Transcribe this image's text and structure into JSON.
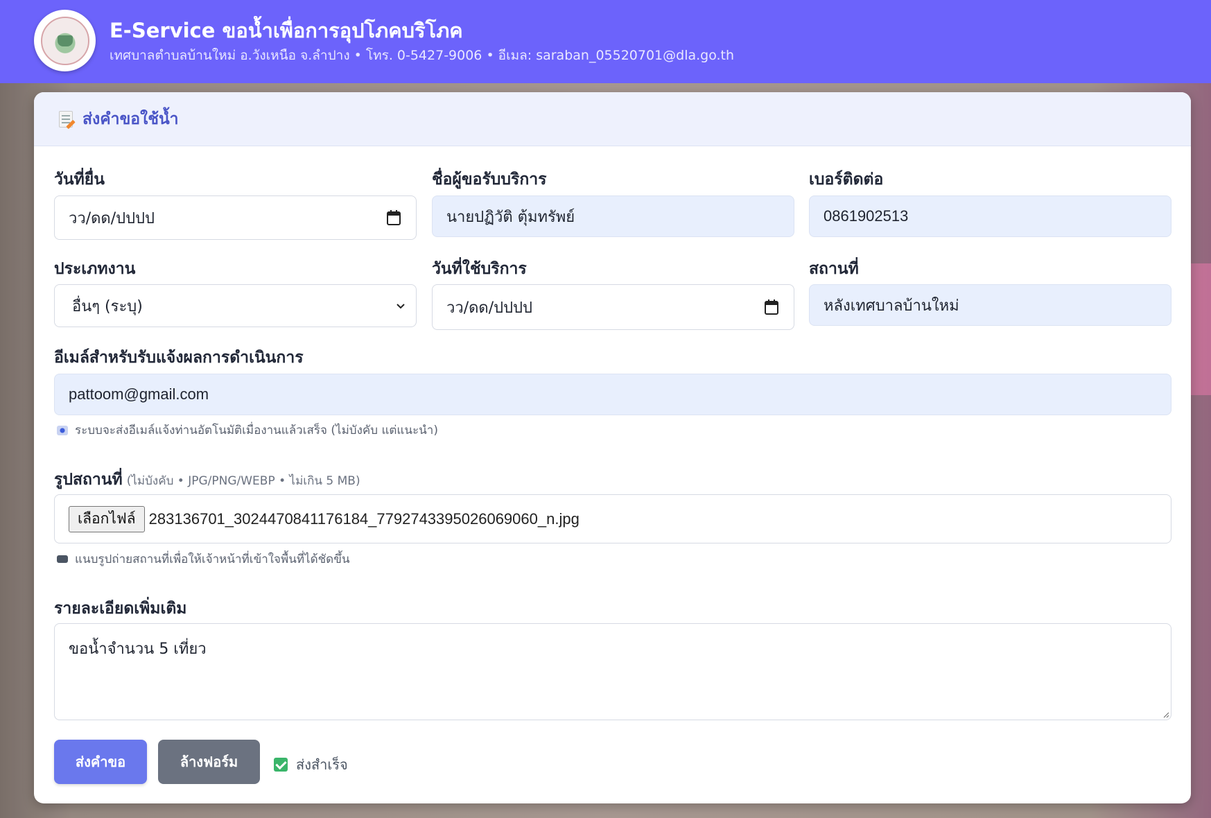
{
  "header": {
    "title": "E-Service ขอน้ำเพื่อการอุปโภคบริโภค",
    "subtitle": "เทศบาลตำบลบ้านใหม่ อ.วังเหนือ จ.ลำปาง • โทร. 0-5427-9006 • อีเมล: saraban_05520701@dla.go.th",
    "accent_color": "#6c63fb",
    "logo_icon": "municipality-seal-icon"
  },
  "card": {
    "title": "ส่งคำขอใช้น้ำ",
    "title_icon": "memo-pencil-icon"
  },
  "form": {
    "submit_date": {
      "label": "วันที่ยื่น",
      "value": "วว/ดด/ปปปป",
      "icon": "calendar-icon"
    },
    "requester_name": {
      "label": "ชื่อผู้ขอรับบริการ",
      "value": "นายปฏิวัติ ตุ้มทรัพย์"
    },
    "phone": {
      "label": "เบอร์ติดต่อ",
      "value": "0861902513"
    },
    "job_type": {
      "label": "ประเภทงาน",
      "value": "อื่นๆ (ระบุ)",
      "icon": "chevron-down-icon"
    },
    "service_date": {
      "label": "วันที่ใช้บริการ",
      "value": "วว/ดด/ปปปป",
      "icon": "calendar-icon"
    },
    "location": {
      "label": "สถานที่",
      "value": "หลังเทศบาลบ้านใหม่"
    },
    "email": {
      "label": "อีเมล์สำหรับรับแจ้งผลการดำเนินการ",
      "value": "pattoom@gmail.com",
      "note": "ระบบจะส่งอีเมล์แจ้งท่านอัตโนมัติเมื่องานแล้วเสร็จ (ไม่บังคับ แต่แนะนำ)",
      "note_icon": "info-icon"
    },
    "photo": {
      "label": "รูปสถานที่",
      "hint": "(ไม่บังคับ • JPG/PNG/WEBP • ไม่เกิน 5 MB)",
      "button_label": "เลือกไฟล์",
      "file_name": "283136701_3024470841176184_7792743395026069060_n.jpg",
      "note": "แนบรูปถ่ายสถานที่เพื่อให้เจ้าหน้าที่เข้าใจพื้นที่ได้ชัดขึ้น",
      "note_icon": "camera-icon"
    },
    "details": {
      "label": "รายละเอียดเพิ่มเติม",
      "value": "ขอน้ำจำนวน 5 เที่ยว"
    }
  },
  "actions": {
    "submit_label": "ส่งคำขอ",
    "reset_label": "ล้างฟอร์ม",
    "status_text": "ส่งสำเร็จ",
    "status_icon": "check-mark-icon",
    "submit_color": "#6a78ed",
    "reset_color": "#6b7280",
    "status_color": "#3ab56a"
  }
}
